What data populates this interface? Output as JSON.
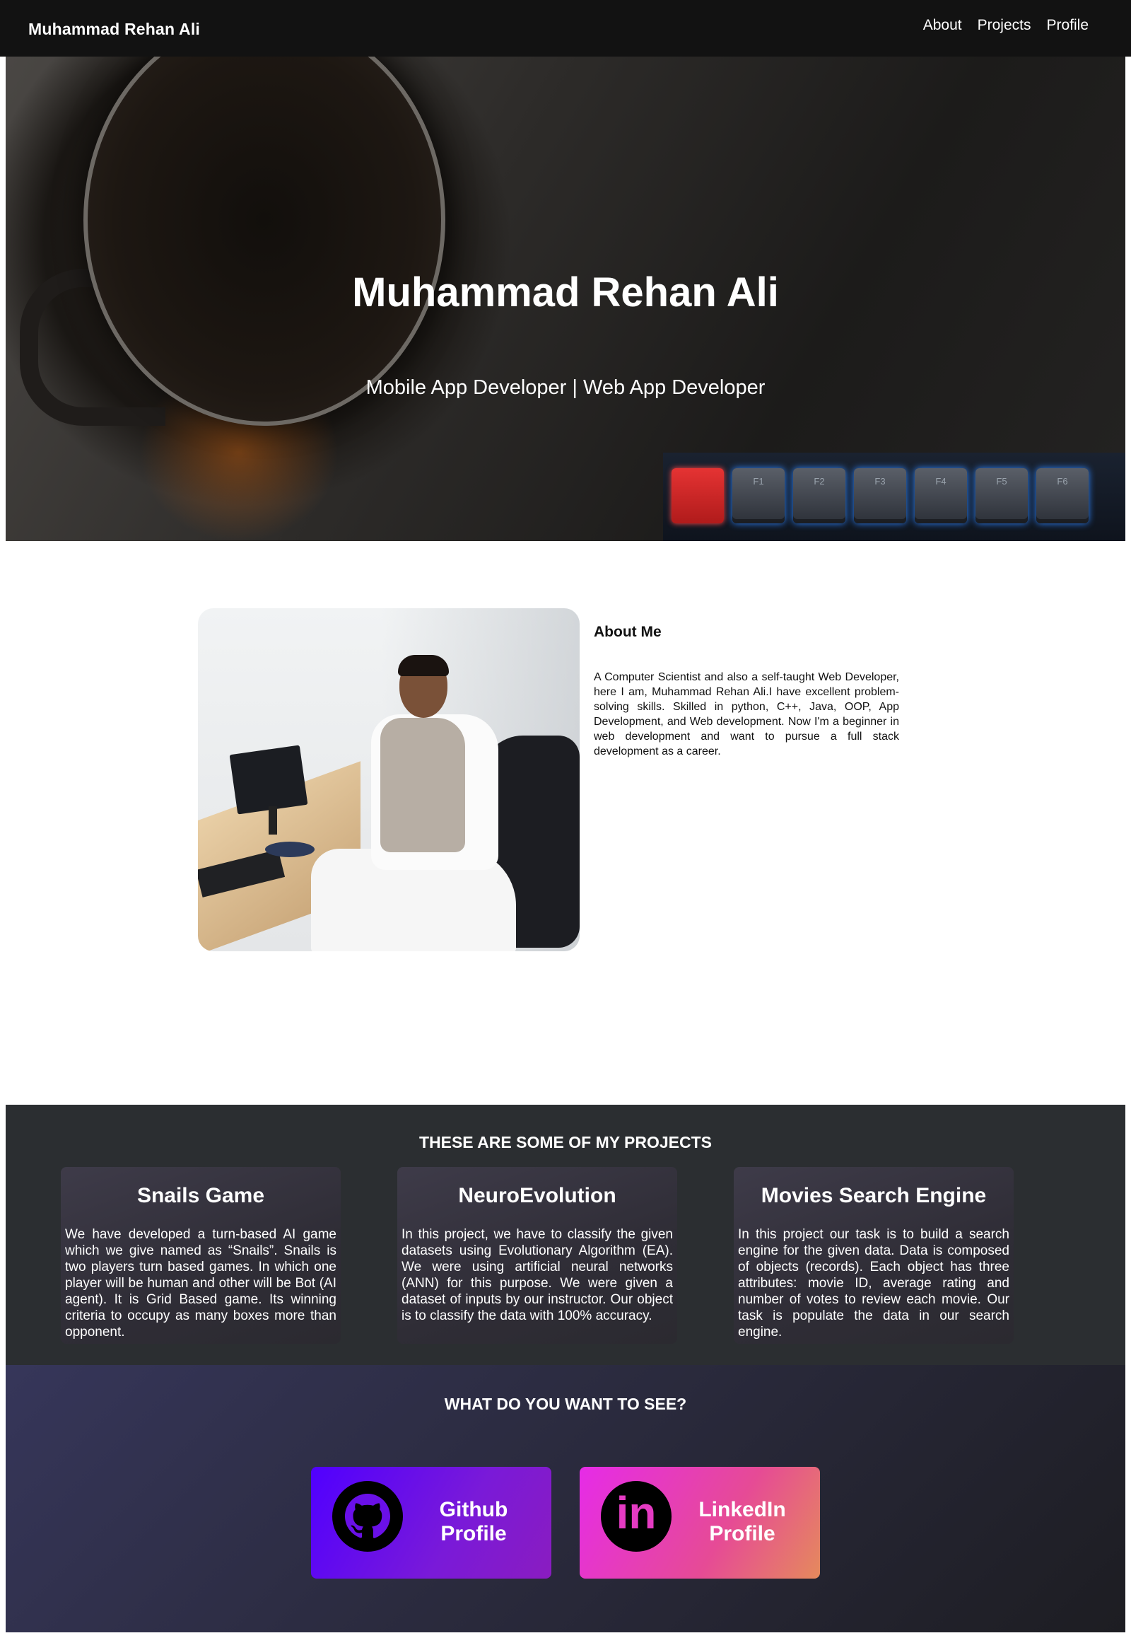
{
  "navbar": {
    "brand": "Muhammad Rehan Ali",
    "links": [
      "About",
      "Projects",
      "Profile"
    ]
  },
  "hero": {
    "title": "Muhammad Rehan Ali",
    "subtitle": "Mobile App Developer | Web App Developer",
    "keys": [
      "",
      "F1",
      "F2",
      "F3",
      "F4",
      "F5",
      "F6"
    ]
  },
  "about": {
    "title": "About Me",
    "text": "A Computer Scientist and also a self-taught Web Developer, here I am, Muhammad Rehan Ali.I have excellent problem-solving skills. Skilled in python, C++, Java, OOP, App Development, and Web development. Now I'm a beginner in web development and want to pursue a full stack development as a career."
  },
  "projects": {
    "heading": "THESE ARE SOME OF MY PROJECTS",
    "cards": [
      {
        "title": "Snails Game",
        "text": "We have developed a turn-based AI game which we give named as “Snails”. Snails is two players turn based games. In which one player will be human and other will be Bot (AI agent). It is Grid Based game. Its winning criteria to occupy as many boxes more than opponent."
      },
      {
        "title": "NeuroEvolution",
        "text": "In this project, we have to classify the given datasets using Evolutionary Algorithm (EA). We were using artificial neural networks (ANN) for this purpose. We were given a dataset of inputs by our instructor. Our object is to classify the data with 100% accuracy."
      },
      {
        "title": "Movies Search Engine",
        "text": "In this project our task is to build a search engine for the given data. Data is composed of objects (records). Each object has three attributes: movie ID, average rating and number of votes to review each movie. Our task is populate the data in our search engine."
      }
    ]
  },
  "contact": {
    "heading": "WHAT DO YOU WANT TO SEE?",
    "github": {
      "line1": "Github",
      "line2": "Profile",
      "icon": "github-icon"
    },
    "linkedin": {
      "line1": "LinkedIn",
      "line2": "Profile",
      "icon": "linkedin-icon",
      "icon_text": "in"
    }
  },
  "colors": {
    "navbar": "#121212",
    "projects_bg": "#2b2e31",
    "github_gradient": [
      "#5000ff",
      "#8a1cc0"
    ],
    "linkedin_gradient": [
      "#e62be8",
      "#e58a5c"
    ]
  }
}
